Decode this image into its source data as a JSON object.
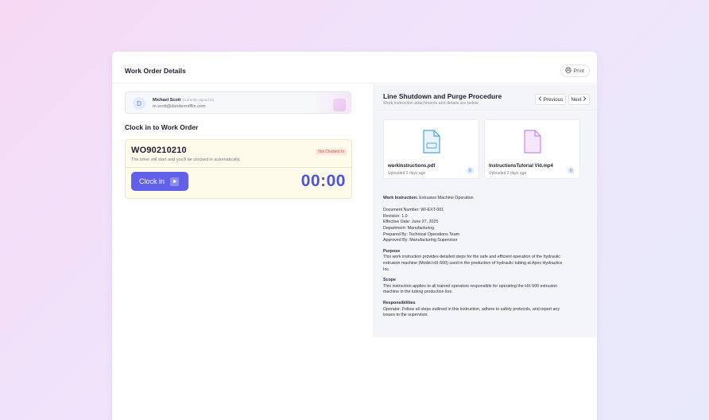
{
  "header": {
    "title": "Work Order Details",
    "print_label": "Print"
  },
  "user": {
    "initial": "D",
    "name": "Michael Scott",
    "note": "(currently signed in)",
    "email": "m.scott@dundermifflin.com"
  },
  "clock_section": {
    "title": "Clock in to Work Order",
    "work_order_number": "WO90210210",
    "subtitle": "The timer will start and you'll be clocked in automatically.",
    "status": "Not Clocked In",
    "status_color": "#d45a3a",
    "button_label": "Clock in",
    "timer": "00:00"
  },
  "document": {
    "title": "Line Shutdown and Purge Procedure",
    "subtitle": "Work instruction attachments and details are below",
    "prev_label": "Previous",
    "next_label": "Next",
    "files": [
      {
        "name": "workInstructions.pdf",
        "uploaded": "Uploaded 2 days ago",
        "uploader_initial": "D",
        "icon": "pdf-file-icon",
        "color": "#4ea3e6"
      },
      {
        "name": "InstructionsTutorial Vid.mp4",
        "uploaded": "Uploaded 2 days ago",
        "uploader_initial": "D",
        "icon": "video-file-icon",
        "color": "#c78de6"
      }
    ]
  },
  "instructions": {
    "wi_label": "Work Instruction:",
    "wi_value": "Extrusion Machine Operation",
    "meta": [
      "Document Number: WI-EXT-001",
      "Revision: 1.0",
      "Effective Date: June 27, 2025",
      "Department: Manufacturing",
      "Prepared By: Technical Operations Team",
      "Approved By: Manufacturing Supervisor"
    ],
    "purpose_heading": "Purpose",
    "purpose_lines": [
      "This work instruction provides detailed steps for the safe and efficient operation of the hydraulic",
      "extrusion machine (Model HX-500) used in the production of hydraulic tubing at Apex Hydraulics",
      "Inc."
    ],
    "scope_heading": "Scope",
    "scope_lines": [
      "This instruction applies to all trained operators responsible for operating the HX-500 extrusion",
      "machine in the tubing production line."
    ],
    "responsibilities_heading": "Responsibilities",
    "responsibilities_lines": [
      "Operator: Follow all steps outlined in this instruction, adhere to safety protocols, and report any",
      "issues to the supervisor."
    ]
  },
  "colors": {
    "accent": "#6060e8",
    "timer": "#4d55d6"
  }
}
